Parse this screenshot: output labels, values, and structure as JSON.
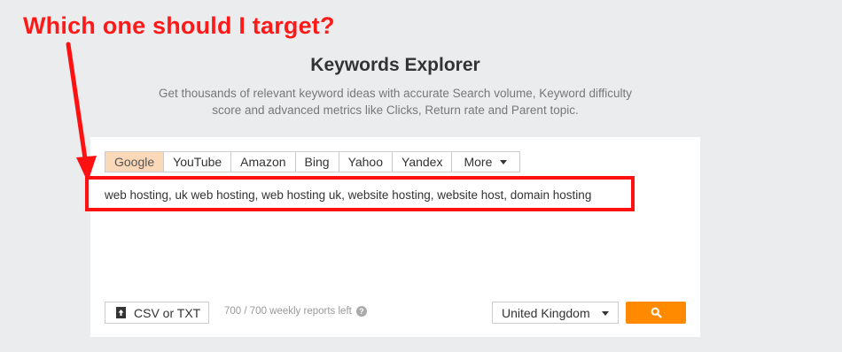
{
  "annotation": {
    "text": "Which one should I target?",
    "color": "#ff1a1a"
  },
  "header": {
    "title": "Keywords Explorer",
    "subtitle_line1": "Get thousands of relevant keyword ideas with accurate Search volume, Keyword difficulty",
    "subtitle_line2": "score and advanced metrics like Clicks, Return rate and Parent topic."
  },
  "tabs": [
    {
      "label": "Google",
      "active": true
    },
    {
      "label": "YouTube",
      "active": false
    },
    {
      "label": "Amazon",
      "active": false
    },
    {
      "label": "Bing",
      "active": false
    },
    {
      "label": "Yahoo",
      "active": false
    },
    {
      "label": "Yandex",
      "active": false
    },
    {
      "label": "More",
      "active": false
    }
  ],
  "input": {
    "value": "web hosting, uk web hosting, web hosting uk, website hosting, website host, domain hosting"
  },
  "footer": {
    "upload_label": "CSV or TXT",
    "upload_icon": "upload-icon",
    "reports_text": "700 / 700 weekly reports left",
    "help_icon": "question-circle-icon",
    "country": "United Kingdom",
    "search_icon": "search-icon"
  },
  "colors": {
    "accent": "#ff8a00",
    "active_tab": "#fbd8b7",
    "page_bg": "#ebecee"
  }
}
